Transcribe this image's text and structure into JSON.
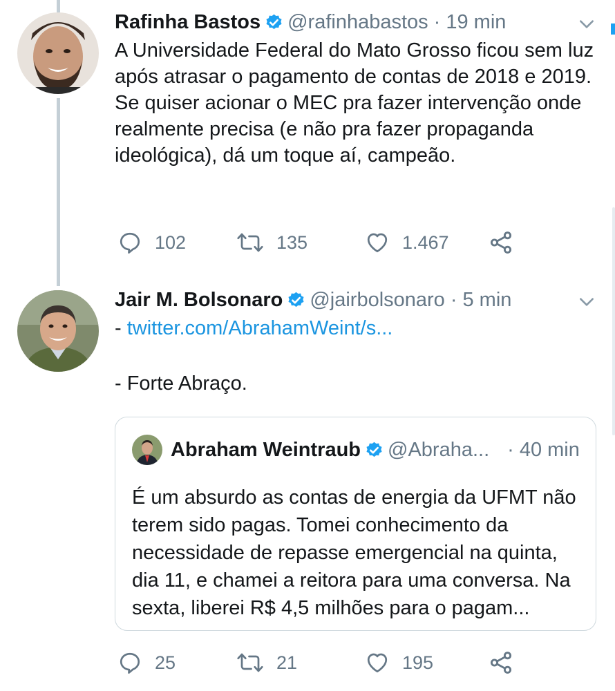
{
  "tweets": [
    {
      "name": "Rafinha Bastos",
      "handle": "@rafinhabastos",
      "separator": "·",
      "time": "19 min",
      "text": "A Universidade Federal do Mato Grosso ficou sem luz após atrasar o pagamento de contas de 2018 e 2019. Se quiser acionar o MEC pra fazer intervenção onde realmente precisa (e não pra fazer propaganda ideológica), dá um toque aí, campeão.",
      "replies": "102",
      "retweets": "135",
      "likes": "1.467"
    },
    {
      "name": "Jair M. Bolsonaro",
      "handle": "@jairbolsonaro",
      "separator": "·",
      "time": "5 min",
      "line1_prefix": "- ",
      "link": "twitter.com/AbrahamWeint/s...",
      "line2": "- Forte Abraço.",
      "replies": "25",
      "retweets": "21",
      "likes": "195",
      "quote": {
        "name": "Abraham Weintraub",
        "handle": "@Abraha...",
        "separator": "·",
        "time": "40 min",
        "text": "É um absurdo as contas de energia da UFMT não terem sido pagas. Tomei conhecimento da necessidade de repasse emergencial na quinta, dia 11, e chamei a reitora para uma conversa. Na sexta, liberei R$ 4,5 milhões para o pagam..."
      }
    }
  ],
  "colors": {
    "text": "#14171a",
    "secondary": "#657786",
    "link": "#1b95e0",
    "verified": "#1da1f2",
    "thread_line": "#c4cfd6"
  },
  "icons": [
    "verified-icon",
    "chevron-down-icon",
    "reply-icon",
    "retweet-icon",
    "like-icon",
    "share-icon"
  ]
}
